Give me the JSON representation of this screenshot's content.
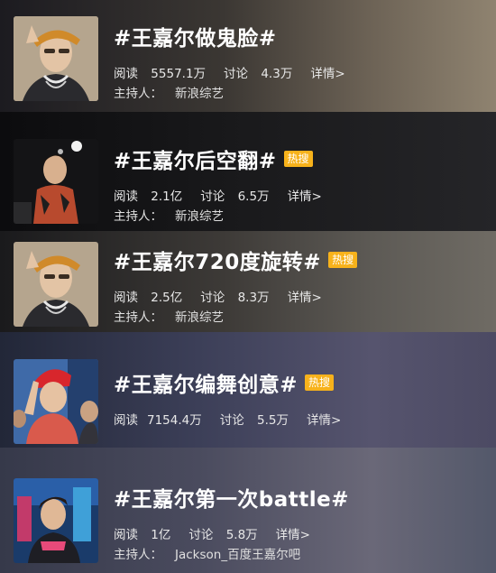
{
  "topics": [
    {
      "title": "#王嘉尔做鬼脸#",
      "hot_badge": "",
      "read_label": "阅读",
      "read_value": "5557.1万",
      "discuss_label": "讨论",
      "discuss_value": "4.3万",
      "detail_label": "详情>",
      "host_label": "主持人：",
      "host_name": "新浪综艺"
    },
    {
      "title": "#王嘉尔后空翻#",
      "hot_badge": "热搜",
      "read_label": "阅读",
      "read_value": "2.1亿",
      "discuss_label": "讨论",
      "discuss_value": "6.5万",
      "detail_label": "详情>",
      "host_label": "主持人：",
      "host_name": "新浪综艺"
    },
    {
      "title": "#王嘉尔720度旋转#",
      "hot_badge": "热搜",
      "read_label": "阅读",
      "read_value": "2.5亿",
      "discuss_label": "讨论",
      "discuss_value": "8.3万",
      "detail_label": "详情>",
      "host_label": "主持人：",
      "host_name": "新浪综艺"
    },
    {
      "title": "#王嘉尔编舞创意#",
      "hot_badge": "热搜",
      "read_label": "阅读",
      "read_value": "7154.4万",
      "discuss_label": "讨论",
      "discuss_value": "5.5万",
      "detail_label": "详情>",
      "host_label": "",
      "host_name": ""
    },
    {
      "title": "#王嘉尔第一次battle#",
      "hot_badge": "",
      "read_label": "阅读",
      "read_value": "1亿",
      "discuss_label": "讨论",
      "discuss_value": "5.8万",
      "detail_label": "详情>",
      "host_label": "主持人：",
      "host_name": "Jackson_百度王嘉尔吧"
    }
  ],
  "colors": {
    "badge": "#f7b21b",
    "title": "#ffffff",
    "meta": "#e8e8e8"
  }
}
